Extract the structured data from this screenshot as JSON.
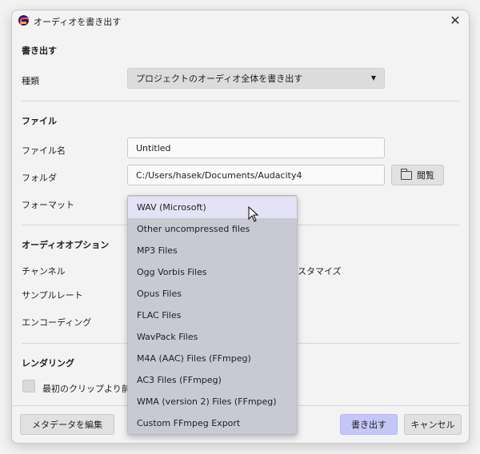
{
  "window": {
    "title": "オーディオを書き出す"
  },
  "export": {
    "section_title": "書き出す",
    "type_label": "種類",
    "type_value": "プロジェクトのオーディオ全体を書き出す"
  },
  "file": {
    "section_title": "ファイル",
    "filename_label": "ファイル名",
    "filename_value": "Untitled",
    "folder_label": "フォルダ",
    "folder_value": "C:/Users/hasek/Documents/Audacity4",
    "browse_label": "閲覧",
    "format_label": "フォーマット"
  },
  "audio_options": {
    "section_title": "オーディオオプション",
    "channel_label": "チャンネル",
    "channel_partial_text": "スタマイズ",
    "samplerate_label": "サンプルレート",
    "encoding_label": "エンコーディング"
  },
  "rendering": {
    "section_title": "レンダリング",
    "checkbox_label": "最初のクリップより前の空"
  },
  "footer": {
    "metadata_button": "メタデータを編集",
    "export_button": "書き出す",
    "cancel_button": "キャンセル"
  },
  "format_dropdown": {
    "items": [
      "WAV (Microsoft)",
      "Other uncompressed files",
      "MP3 Files",
      "Ogg Vorbis Files",
      "Opus Files",
      "FLAC Files",
      "WavPack Files",
      "M4A (AAC) Files (FFmpeg)",
      "AC3 Files (FFmpeg)",
      "WMA (version 2) Files (FFmpeg)",
      "Custom FFmpeg Export"
    ],
    "selected_index": 0
  },
  "colors": {
    "primary_button": "#c5c6f8",
    "dropdown_bg": "#c8c9d3",
    "dropdown_selected": "#e3e3f5"
  }
}
